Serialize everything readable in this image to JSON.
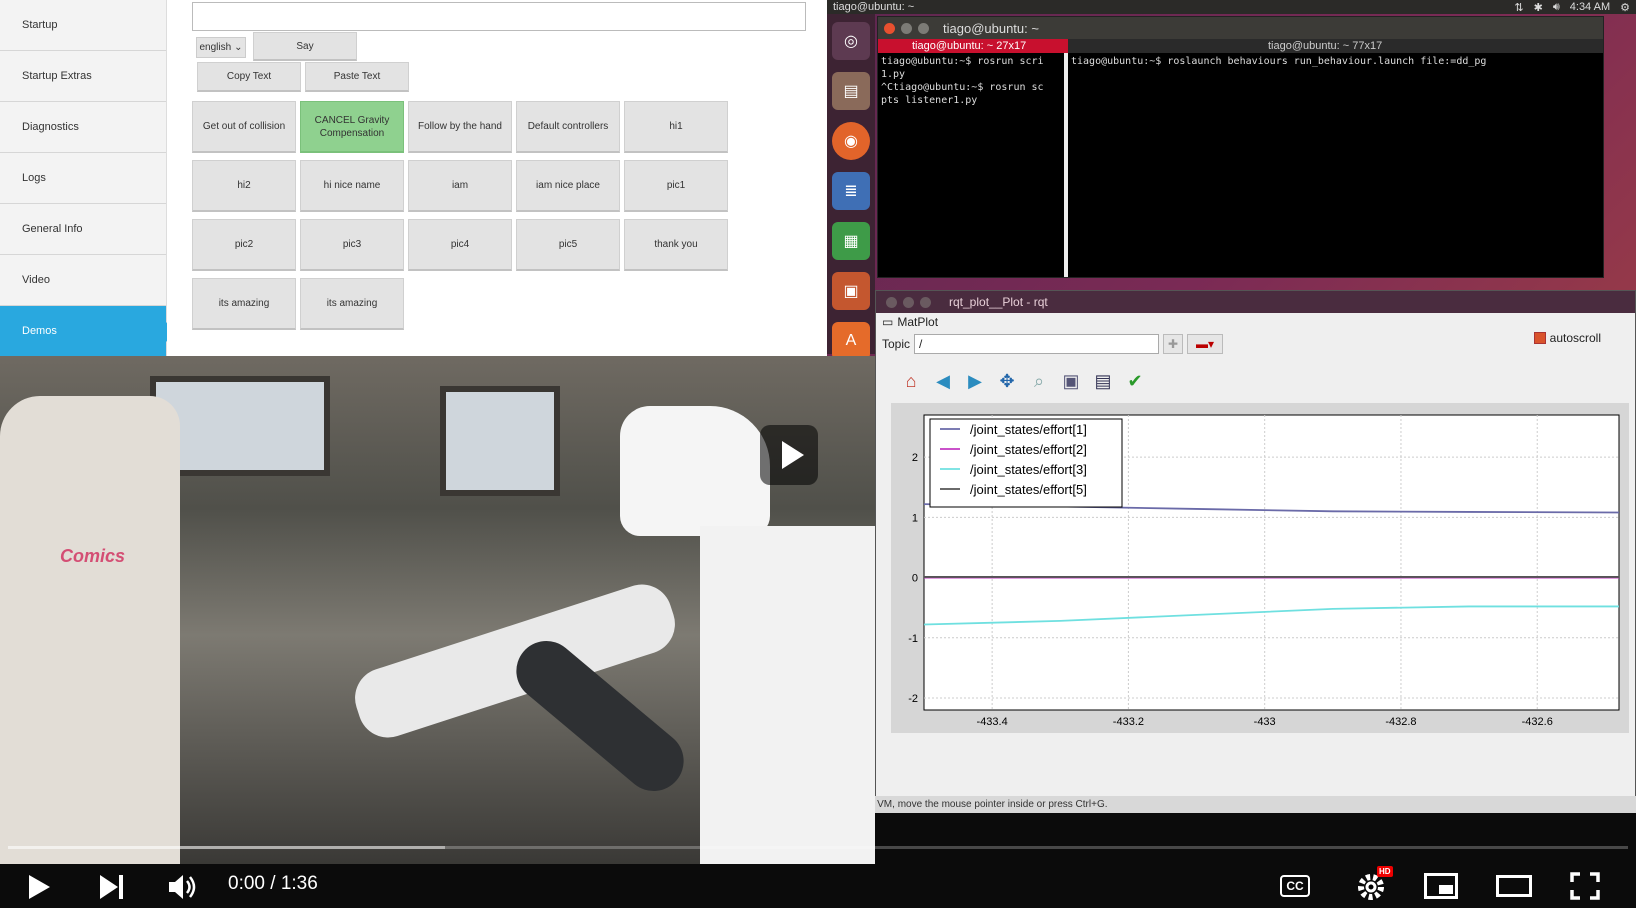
{
  "sidebar": {
    "items": [
      {
        "label": "Startup"
      },
      {
        "label": "Startup Extras"
      },
      {
        "label": "Diagnostics"
      },
      {
        "label": "Logs"
      },
      {
        "label": "General Info"
      },
      {
        "label": "Video"
      },
      {
        "label": "Demos"
      }
    ],
    "active_index": 6
  },
  "tts": {
    "input_value": "",
    "language": "english",
    "say_label": "Say",
    "copy_label": "Copy Text",
    "paste_label": "Paste Text"
  },
  "demo_buttons": [
    {
      "label": "Get out of collision",
      "state": "normal"
    },
    {
      "label": "CANCEL Gravity Compensation",
      "state": "active"
    },
    {
      "label": "Follow by the hand",
      "state": "normal"
    },
    {
      "label": "Default controllers",
      "state": "normal"
    },
    {
      "label": "hi1",
      "state": "normal"
    },
    {
      "label": "hi2",
      "state": "normal"
    },
    {
      "label": "hi nice name",
      "state": "normal"
    },
    {
      "label": "iam",
      "state": "normal"
    },
    {
      "label": "iam nice place",
      "state": "normal"
    },
    {
      "label": "pic1",
      "state": "normal"
    },
    {
      "label": "pic2",
      "state": "normal"
    },
    {
      "label": "pic3",
      "state": "normal"
    },
    {
      "label": "pic4",
      "state": "normal"
    },
    {
      "label": "pic5",
      "state": "normal"
    },
    {
      "label": "thank you",
      "state": "normal"
    },
    {
      "label": "its amazing",
      "state": "normal"
    },
    {
      "label": "its amazing",
      "state": "normal"
    }
  ],
  "desktop": {
    "topbar_title": "tiago@ubuntu: ~",
    "clock": "4:34 AM",
    "status_bar": "out to this VM, move the mouse pointer inside or press Ctrl+G."
  },
  "terminal": {
    "title": "tiago@ubuntu: ~",
    "tab1": "tiago@ubuntu: ~ 27x17",
    "tab2": "tiago@ubuntu: ~ 77x17",
    "pane1_lines": [
      "tiago@ubuntu:~$ rosrun scri",
      "1.py",
      "^Ctiago@ubuntu:~$ rosrun sc",
      "pts listener1.py"
    ],
    "pane2_lines": [
      "tiago@ubuntu:~$ roslaunch behaviours run_behaviour.launch file:=dd_pg"
    ]
  },
  "rqt": {
    "title": "rqt_plot__Plot - rqt",
    "matplot_label": "MatPlot",
    "topic_label": "Topic",
    "topic_value": "/",
    "autoscroll_label": "autoscroll",
    "autoscroll_checked": true
  },
  "chart_data": {
    "type": "line",
    "title": "",
    "xlabel": "",
    "ylabel": "",
    "xlim": [
      -433.5,
      -432.48
    ],
    "ylim": [
      -2.2,
      2.7
    ],
    "x_ticks": [
      -433.4,
      -433.2,
      -433.0,
      -432.8,
      -432.6
    ],
    "y_ticks": [
      -2,
      -1,
      0,
      1,
      2
    ],
    "grid": true,
    "legend_position": "top-left",
    "series": [
      {
        "name": "/joint_states/effort[1]",
        "color": "#6a6aa8",
        "x": [
          -433.5,
          -433.3,
          -433.1,
          -432.9,
          -432.7,
          -432.48
        ],
        "y": [
          1.22,
          1.18,
          1.14,
          1.1,
          1.09,
          1.08
        ]
      },
      {
        "name": "/joint_states/effort[2]",
        "color": "#c23ac2",
        "x": [
          -433.5,
          -433.3,
          -433.1,
          -432.9,
          -432.7,
          -432.48
        ],
        "y": [
          0.0,
          0.0,
          0.0,
          0.0,
          0.0,
          0.0
        ]
      },
      {
        "name": "/joint_states/effort[3]",
        "color": "#6fe0e0",
        "x": [
          -433.5,
          -433.3,
          -433.1,
          -432.9,
          -432.7,
          -432.48
        ],
        "y": [
          -0.78,
          -0.72,
          -0.62,
          -0.52,
          -0.48,
          -0.48
        ]
      },
      {
        "name": "/joint_states/effort[5]",
        "color": "#555555",
        "x": [
          -433.5,
          -433.3,
          -433.1,
          -432.9,
          -432.7,
          -432.48
        ],
        "y": [
          0.01,
          0.01,
          0.01,
          0.01,
          0.01,
          0.01
        ]
      }
    ]
  },
  "video": {
    "shirt_text": "Comics",
    "current_time": "0:00",
    "duration": "1:36",
    "time_display": "0:00 / 1:36",
    "progress": 0,
    "buffered": 0.27,
    "hd_badge": "HD",
    "cc_label": "CC"
  }
}
